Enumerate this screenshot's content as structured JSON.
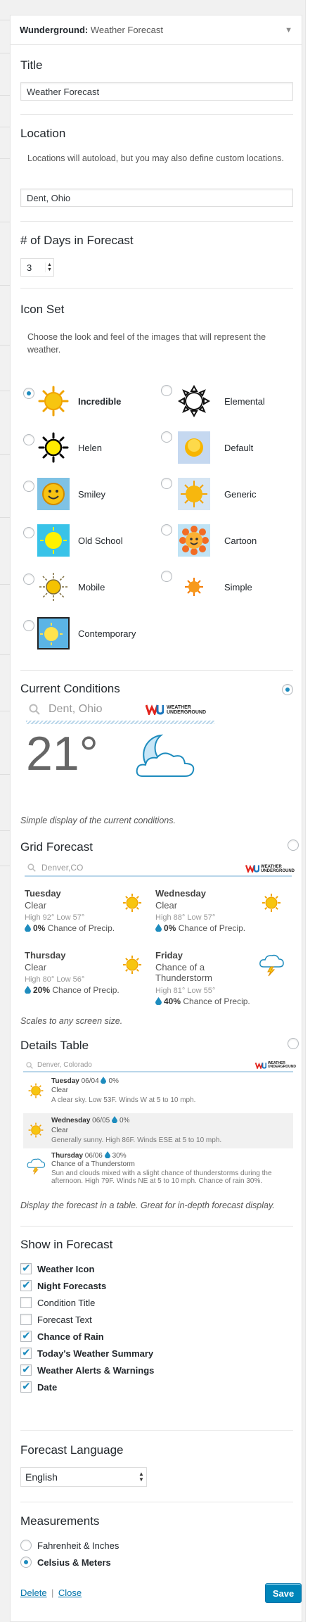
{
  "widget": {
    "plugin": "Wunderground:",
    "name": "Weather Forecast"
  },
  "title": {
    "heading": "Title",
    "value": "Weather Forecast"
  },
  "location": {
    "heading": "Location",
    "description": "Locations will autoload, but you may also define custom locations.",
    "value": "Dent, Ohio"
  },
  "days": {
    "heading": "# of Days in Forecast",
    "value": "3"
  },
  "iconset": {
    "heading": "Icon Set",
    "description": "Choose the look and feel of the images that will represent the weather.",
    "options": [
      {
        "label": "Incredible",
        "selected": true
      },
      {
        "label": "Elemental",
        "selected": false
      },
      {
        "label": "Helen",
        "selected": false
      },
      {
        "label": "Default",
        "selected": false
      },
      {
        "label": "Smiley",
        "selected": false
      },
      {
        "label": "Generic",
        "selected": false
      },
      {
        "label": "Old School",
        "selected": false
      },
      {
        "label": "Cartoon",
        "selected": false
      },
      {
        "label": "Mobile",
        "selected": false
      },
      {
        "label": "Simple",
        "selected": false
      },
      {
        "label": "Contemporary",
        "selected": false
      }
    ]
  },
  "layouts": {
    "current": {
      "heading": "Current Conditions",
      "search": "Dent, Ohio",
      "temp": "21°",
      "caption": "Simple display of the current conditions.",
      "selected": true
    },
    "grid": {
      "heading": "Grid Forecast",
      "search": "Denver,CO",
      "caption": "Scales to any screen size.",
      "selected": false,
      "days": [
        {
          "day": "Tuesday",
          "cond": "Clear",
          "hl": "High 92° Low 57°",
          "pct": "0%",
          "precip": "Chance of Precip."
        },
        {
          "day": "Wednesday",
          "cond": "Clear",
          "hl": "High 88° Low 57°",
          "pct": "0%",
          "precip": "Chance of Precip."
        },
        {
          "day": "Thursday",
          "cond": "Clear",
          "hl": "High 80° Low 56°",
          "pct": "20%",
          "precip": "Chance of Precip."
        },
        {
          "day": "Friday",
          "cond": "Chance of a Thunderstorm",
          "hl": "High 81° Low 55°",
          "pct": "40%",
          "precip": "Chance of Precip."
        }
      ]
    },
    "table": {
      "heading": "Details Table",
      "search": "Denver, Colorado",
      "caption": "Display the forecast in a table. Great for in-depth forecast display.",
      "selected": false,
      "rows": [
        {
          "day": "Tuesday",
          "date": "06/04",
          "pct": "0%",
          "cond": "Clear",
          "summary": "A clear sky. Low 53F. Winds W at 5 to 10 mph."
        },
        {
          "day": "Wednesday",
          "date": "06/05",
          "pct": "0%",
          "cond": "Clear",
          "summary": "Generally sunny. High 86F. Winds ESE at 5 to 10 mph."
        },
        {
          "day": "Thursday",
          "date": "06/06",
          "pct": "30%",
          "cond": "Chance of a Thunderstorm",
          "summary": "Sun and clouds mixed with a slight chance of thunderstorms during the afternoon. High 79F. Winds NE at 5 to 10 mph. Chance of rain 30%."
        }
      ]
    }
  },
  "brand": {
    "line1": "WEATHER",
    "line2": "UNDERGROUND",
    "mark": "WU"
  },
  "show": {
    "heading": "Show in Forecast",
    "items": [
      {
        "label": "Weather Icon",
        "checked": true
      },
      {
        "label": "Night Forecasts",
        "checked": true
      },
      {
        "label": "Condition Title",
        "checked": false
      },
      {
        "label": "Forecast Text",
        "checked": false
      },
      {
        "label": "Chance of Rain",
        "checked": true
      },
      {
        "label": "Today's Weather Summary",
        "checked": true
      },
      {
        "label": "Weather Alerts & Warnings",
        "checked": true
      },
      {
        "label": "Date",
        "checked": true
      }
    ]
  },
  "language": {
    "heading": "Forecast Language",
    "value": "English"
  },
  "measurements": {
    "heading": "Measurements",
    "options": [
      {
        "label": "Fahrenheit & Inches",
        "selected": false
      },
      {
        "label": "Celsius & Meters",
        "selected": true
      }
    ]
  },
  "footer": {
    "delete": "Delete",
    "sep": "|",
    "close": "Close",
    "save": "Save"
  },
  "colors": {
    "accent": "#0085ba",
    "link": "#0073aa",
    "radio": "#1e8cbe"
  }
}
